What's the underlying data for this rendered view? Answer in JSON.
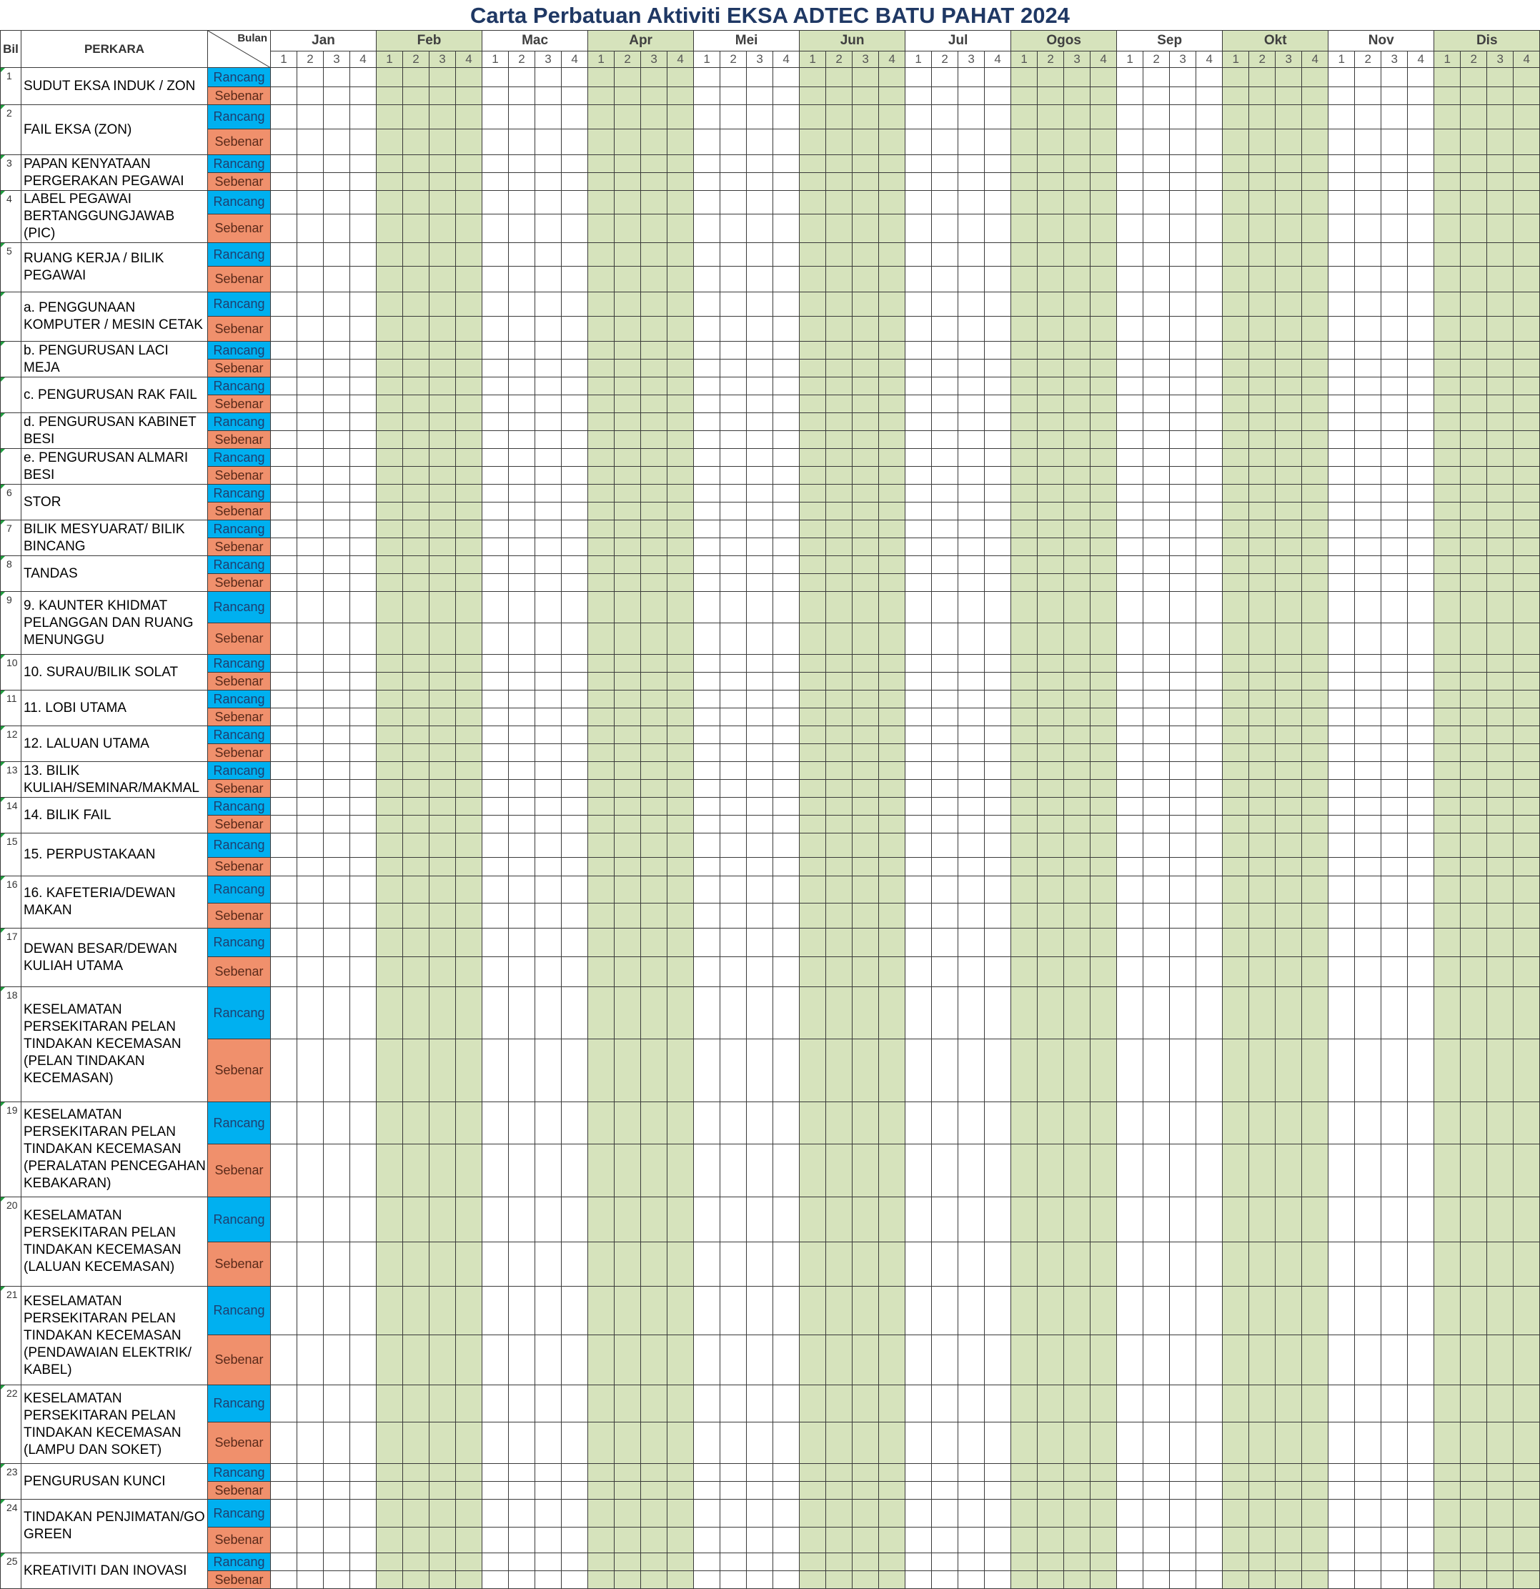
{
  "title": "Carta Perbatuan Aktiviti  EKSA ADTEC BATU PAHAT 2024",
  "headers": {
    "bil": "Bil",
    "perkara": "PERKARA",
    "bulan": "Bulan"
  },
  "months": [
    "Jan",
    "Feb",
    "Mac",
    "Apr",
    "Mei",
    "Jun",
    "Jul",
    "Ogos",
    "Sep",
    "Okt",
    "Nov",
    "Dis"
  ],
  "weeks": [
    "1",
    "2",
    "3",
    "4"
  ],
  "status_labels": {
    "plan": "Rancang",
    "actual": "Sebenar"
  },
  "colors": {
    "plan": "#00b0f0",
    "actual": "#f0906c",
    "shade": "#d6e3bc",
    "title": "#1f3864"
  },
  "rows": [
    {
      "bil": "1",
      "perkara": "SUDUT EKSA INDUK / ZON"
    },
    {
      "bil": "2",
      "perkara": "FAIL EKSA (ZON)"
    },
    {
      "bil": "3",
      "perkara": "PAPAN KENYATAAN PERGERAKAN PEGAWAI"
    },
    {
      "bil": "4",
      "perkara": "LABEL PEGAWAI BERTANGGUNGJAWAB (PIC)"
    },
    {
      "bil": "5",
      "perkara": "RUANG KERJA / BILIK PEGAWAI"
    },
    {
      "bil": "",
      "perkara": "a. PENGGUNAAN KOMPUTER / MESIN CETAK"
    },
    {
      "bil": "",
      "perkara": "b. PENGURUSAN LACI MEJA"
    },
    {
      "bil": "",
      "perkara": "c. PENGURUSAN RAK FAIL"
    },
    {
      "bil": "",
      "perkara": "d. PENGURUSAN KABINET BESI"
    },
    {
      "bil": "",
      "perkara": "e. PENGURUSAN ALMARI BESI"
    },
    {
      "bil": "6",
      "perkara": "STOR"
    },
    {
      "bil": "7",
      "perkara": "BILIK MESYUARAT/ BILIK BINCANG"
    },
    {
      "bil": "8",
      "perkara": "TANDAS"
    },
    {
      "bil": "9",
      "perkara": "9. KAUNTER KHIDMAT PELANGGAN DAN RUANG MENUNGGU"
    },
    {
      "bil": "10",
      "perkara": "10. SURAU/BILIK SOLAT"
    },
    {
      "bil": "11",
      "perkara": "11. LOBI UTAMA"
    },
    {
      "bil": "12",
      "perkara": "12. LALUAN UTAMA"
    },
    {
      "bil": "13",
      "perkara": "13. BILIK KULIAH/SEMINAR/MAKMAL"
    },
    {
      "bil": "14",
      "perkara": "14. BILIK FAIL"
    },
    {
      "bil": "15",
      "perkara": "15. PERPUSTAKAAN"
    },
    {
      "bil": "16",
      "perkara": "16. KAFETERIA/DEWAN MAKAN"
    },
    {
      "bil": "17",
      "perkara": "DEWAN BESAR/DEWAN KULIAH UTAMA"
    },
    {
      "bil": "18",
      "perkara": "KESELAMATAN PERSEKITARAN PELAN TINDAKAN KECEMASAN (PELAN TINDAKAN KECEMASAN)"
    },
    {
      "bil": "19",
      "perkara": "KESELAMATAN PERSEKITARAN PELAN TINDAKAN KECEMASAN (PERALATAN PENCEGAHAN KEBAKARAN)"
    },
    {
      "bil": "20",
      "perkara": "KESELAMATAN PERSEKITARAN PELAN TINDAKAN KECEMASAN (LALUAN KECEMASAN)"
    },
    {
      "bil": "21",
      "perkara": "KESELAMATAN PERSEKITARAN PELAN TINDAKAN KECEMASAN (PENDAWAIAN ELEKTRIK/ KABEL)"
    },
    {
      "bil": "22",
      "perkara": "KESELAMATAN PERSEKITARAN PELAN TINDAKAN KECEMASAN (LAMPU DAN SOKET)"
    },
    {
      "bil": "23",
      "perkara": "PENGURUSAN KUNCI"
    },
    {
      "bil": "24",
      "perkara": "TINDAKAN PENJIMATAN/GO GREEN"
    },
    {
      "bil": "25",
      "perkara": "KREATIVITI DAN INOVASI"
    }
  ]
}
